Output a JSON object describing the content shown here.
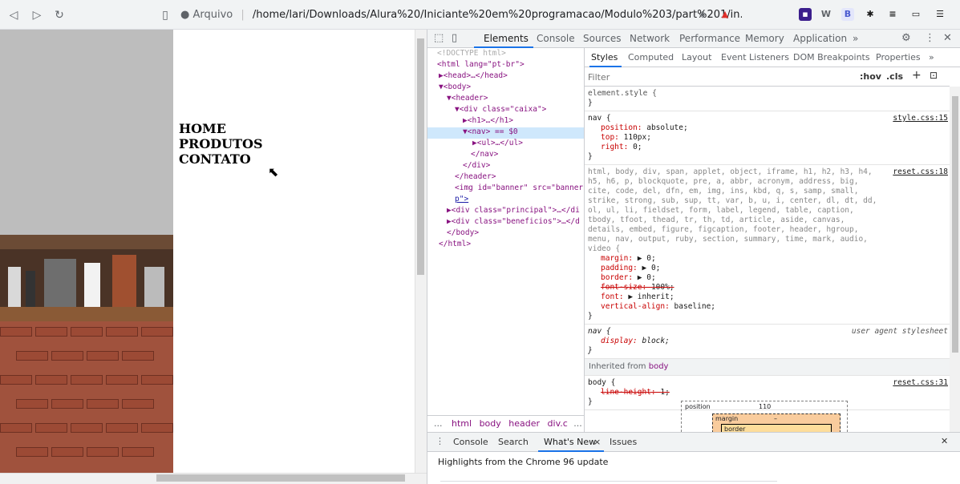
{
  "browser": {
    "security_label": "Arquivo",
    "url": "/home/lari/Downloads/Alura%20/Iniciante%20em%20programacao/Modulo%203/part%201/in..."
  },
  "page": {
    "nav_items": [
      "HOME",
      "PRODUTOS",
      "CONTATO"
    ]
  },
  "devtools": {
    "tabs": [
      "Elements",
      "Console",
      "Sources",
      "Network",
      "Performance",
      "Memory",
      "Application",
      "»"
    ],
    "dom": [
      {
        "text": "<!DOCTYPE html>"
      },
      {
        "text": "<html lang=\"pt-br\">"
      },
      {
        "text": "▶<head>…</head>"
      },
      {
        "text": "▼<body>"
      },
      {
        "text": "▼<header>"
      },
      {
        "text": "▼<div class=\"caixa\">"
      },
      {
        "text": "▶<h1>…</h1>"
      },
      {
        "text": "▼<nav> == $0"
      },
      {
        "text": "▶<ul>…</ul>"
      },
      {
        "text": "</nav>"
      },
      {
        "text": "</div>"
      },
      {
        "text": "</header>"
      },
      {
        "text": "<img id=\"banner\" src=\"banner"
      },
      {
        "text": "p\">"
      },
      {
        "text": "▶<div class=\"principal\">…</di"
      },
      {
        "text": "▶<div class=\"beneficios\">…</d"
      },
      {
        "text": "</body>"
      },
      {
        "text": "</html>"
      }
    ],
    "breadcrumbs": [
      "...",
      "html",
      "body",
      "header",
      "div.c",
      "..."
    ],
    "styles_tabs": [
      "Styles",
      "Computed",
      "Layout",
      "Event Listeners",
      "DOM Breakpoints",
      "Properties",
      "»"
    ],
    "filter_placeholder": "Filter",
    "filter_hov": ":hov",
    "filter_cls": ".cls",
    "rules": {
      "element_style": "element.style {",
      "nav_rule": {
        "selector": "nav {",
        "source": "style.css:15",
        "props": [
          {
            "name": "position",
            "value": "absolute;"
          },
          {
            "name": "top",
            "value": "110px;"
          },
          {
            "name": "right",
            "value": "0;"
          }
        ]
      },
      "reset_rule": {
        "selector": "html, body, div, span, applet, object, iframe, h1, h2, h3, h4, h5, h6, p, blockquote, pre, a, abbr, acronym, address, big, cite, code, del, dfn, em, img, ins, kbd, q, s, samp, small, strike, strong, sub, sup, tt, var, b, u, i, center, dl, dt, dd, ol, ul, li, fieldset, form, label, legend, table, caption, tbody, tfoot, thead, tr, th, td, article, aside, canvas, details, embed, figure, figcaption, footer, header, hgroup, menu, nav, output, ruby, section, summary, time, mark, audio, video {",
        "source": "reset.css:18",
        "props": [
          {
            "name": "margin",
            "value": "▶ 0;"
          },
          {
            "name": "padding",
            "value": "▶ 0;"
          },
          {
            "name": "border",
            "value": "▶ 0;"
          },
          {
            "name": "font-size",
            "value": "100%;"
          },
          {
            "name": "font",
            "value": "▶ inherit;"
          },
          {
            "name": "vertical-align",
            "value": "baseline;"
          }
        ]
      },
      "ua_rule": {
        "selector": "nav {",
        "source": "user agent stylesheet",
        "props": [
          {
            "name": "display",
            "value": "block;"
          }
        ]
      },
      "inherited_label": "Inherited from",
      "inherited_from": "body",
      "body_rule": {
        "selector": "body {",
        "source": "reset.css:31",
        "props": [
          {
            "name": "line-height",
            "value": "1;"
          }
        ]
      },
      "close_brace": "}"
    },
    "box_model": {
      "position_label": "position",
      "position_value": "110",
      "margin_label": "margin",
      "margin_value": "–",
      "border_label": "border"
    },
    "drawer_tabs": [
      "Console",
      "Search",
      "What's New",
      "Issues"
    ],
    "drawer_headline": "Highlights from the Chrome 96 update"
  }
}
